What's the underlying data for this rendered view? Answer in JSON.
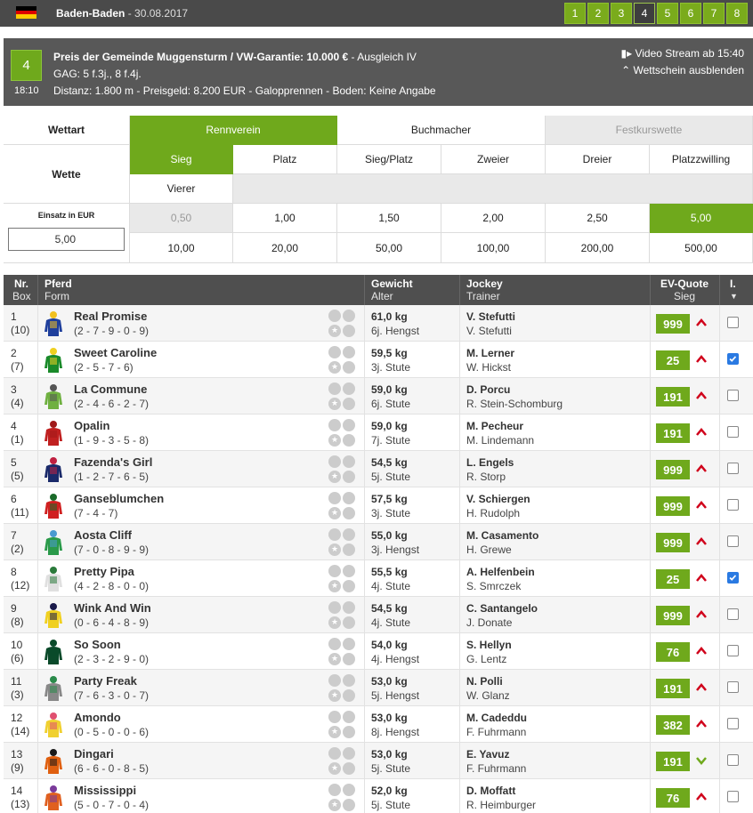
{
  "header": {
    "flag_colors": [
      "#000000",
      "#dd0000",
      "#ffcc00"
    ],
    "meeting": "Baden-Baden",
    "date": "30.08.2017",
    "race_numbers": [
      "1",
      "2",
      "3",
      "4",
      "5",
      "6",
      "7",
      "8"
    ],
    "active_race": "4"
  },
  "race": {
    "number": "4",
    "time": "18:10",
    "title": "Preis der Gemeinde Muggensturm / VW-Garantie: 10.000 €",
    "class": " - Ausgleich IV",
    "gag": "GAG: 5 f.3j., 8 f.4j.",
    "details": "Distanz: 1.800 m - Preisgeld: 8.200 EUR - Galopprennen - Boden: Keine Angabe",
    "video_stream": "Video Stream ab 15:40",
    "hide_ticket": "Wettschein ausblenden"
  },
  "bet": {
    "wettart_label": "Wettart",
    "providers": [
      "Rennverein",
      "Buchmacher",
      "Festkurswette"
    ],
    "wette_label": "Wette",
    "bet_types": [
      "Sieg",
      "Platz",
      "Sieg/Platz",
      "Zweier",
      "Dreier",
      "Platzzwilling"
    ],
    "bet_types_row2": [
      "Vierer"
    ],
    "einsatz_label": "Einsatz in EUR",
    "einsatz_value": "5,00",
    "stakes_row1": [
      "0,50",
      "1,00",
      "1,50",
      "2,00",
      "2,50",
      "5,00"
    ],
    "stakes_row2": [
      "10,00",
      "20,00",
      "50,00",
      "100,00",
      "200,00",
      "500,00"
    ]
  },
  "table": {
    "headers": {
      "nr": "Nr.",
      "box": "Box",
      "pferd": "Pferd",
      "form": "Form",
      "gewicht": "Gewicht",
      "alter": "Alter",
      "jockey": "Jockey",
      "trainer": "Trainer",
      "quote": "EV-Quote",
      "sieg": "Sieg",
      "i": "I."
    },
    "rows": [
      {
        "nr": "1",
        "box": "(10)",
        "name": "Real Promise",
        "form": "(2 - 7 - 9 - 0 - 9)",
        "weight": "61,0 kg",
        "age": "6j. Hengst",
        "jockey": "V. Stefutti",
        "trainer": "V. Stefutti",
        "odds": "999",
        "trend": "up",
        "checked": false,
        "silk": [
          "#f0c020",
          "#1f3f9c"
        ]
      },
      {
        "nr": "2",
        "box": "(7)",
        "name": "Sweet Caroline",
        "form": "(2 - 5 - 7 - 6)",
        "weight": "59,5 kg",
        "age": "3j. Stute",
        "jockey": "M. Lerner",
        "trainer": "W. Hickst",
        "odds": "25",
        "trend": "up",
        "checked": true,
        "silk": [
          "#f0d020",
          "#1a8a2a"
        ]
      },
      {
        "nr": "3",
        "box": "(4)",
        "name": "La Commune",
        "form": "(2 - 4 - 6 - 2 - 7)",
        "weight": "59,0 kg",
        "age": "6j. Stute",
        "jockey": "D. Porcu",
        "trainer": "R. Stein-Schomburg",
        "odds": "191",
        "trend": "up",
        "checked": false,
        "silk": [
          "#555555",
          "#6fb040"
        ]
      },
      {
        "nr": "4",
        "box": "(1)",
        "name": "Opalin",
        "form": "(1 - 9 - 3 - 5 - 8)",
        "weight": "59,0 kg",
        "age": "7j. Stute",
        "jockey": "M. Pecheur",
        "trainer": "M. Lindemann",
        "odds": "191",
        "trend": "up",
        "checked": false,
        "silk": [
          "#a01a1a",
          "#c02020"
        ]
      },
      {
        "nr": "5",
        "box": "(5)",
        "name": "Fazenda's Girl",
        "form": "(1 - 2 - 7 - 6 - 5)",
        "weight": "54,5 kg",
        "age": "5j. Stute",
        "jockey": "L. Engels",
        "trainer": "R. Storp",
        "odds": "999",
        "trend": "up",
        "checked": false,
        "silk": [
          "#c02040",
          "#1a2a6a"
        ]
      },
      {
        "nr": "6",
        "box": "(11)",
        "name": "Ganseblumchen",
        "form": "(7 - 4 - 7)",
        "weight": "57,5 kg",
        "age": "3j. Stute",
        "jockey": "V. Schiergen",
        "trainer": "H. Rudolph",
        "odds": "999",
        "trend": "up",
        "checked": false,
        "silk": [
          "#1a6a2a",
          "#d02020"
        ]
      },
      {
        "nr": "7",
        "box": "(2)",
        "name": "Aosta Cliff",
        "form": "(7 - 0 - 8 - 9 - 9)",
        "weight": "55,0 kg",
        "age": "3j. Hengst",
        "jockey": "M. Casamento",
        "trainer": "H. Grewe",
        "odds": "999",
        "trend": "up",
        "checked": false,
        "silk": [
          "#4a9ad0",
          "#2a9a4a"
        ]
      },
      {
        "nr": "8",
        "box": "(12)",
        "name": "Pretty Pipa",
        "form": "(4 - 2 - 8 - 0 - 0)",
        "weight": "55,5 kg",
        "age": "4j. Stute",
        "jockey": "A. Helfenbein",
        "trainer": "S. Smrczek",
        "odds": "25",
        "trend": "up",
        "checked": true,
        "silk": [
          "#2a7a3a",
          "#e0e0e0"
        ]
      },
      {
        "nr": "9",
        "box": "(8)",
        "name": "Wink And Win",
        "form": "(0 - 6 - 4 - 8 - 9)",
        "weight": "54,5 kg",
        "age": "4j. Stute",
        "jockey": "C. Santangelo",
        "trainer": "J. Donate",
        "odds": "999",
        "trend": "up",
        "checked": false,
        "silk": [
          "#1a1a4a",
          "#f0d020"
        ]
      },
      {
        "nr": "10",
        "box": "(6)",
        "name": "So Soon",
        "form": "(2 - 3 - 2 - 9 - 0)",
        "weight": "54,0 kg",
        "age": "4j. Hengst",
        "jockey": "S. Hellyn",
        "trainer": "G. Lentz",
        "odds": "76",
        "trend": "up",
        "checked": false,
        "silk": [
          "#0a4a2a",
          "#0a4a2a"
        ]
      },
      {
        "nr": "11",
        "box": "(3)",
        "name": "Party Freak",
        "form": "(7 - 6 - 3 - 0 - 7)",
        "weight": "53,0 kg",
        "age": "5j. Hengst",
        "jockey": "N. Polli",
        "trainer": "W. Glanz",
        "odds": "191",
        "trend": "up",
        "checked": false,
        "silk": [
          "#2a8a4a",
          "#888888"
        ]
      },
      {
        "nr": "12",
        "box": "(14)",
        "name": "Amondo",
        "form": "(0 - 5 - 0 - 0 - 6)",
        "weight": "53,0 kg",
        "age": "8j. Hengst",
        "jockey": "M. Cadeddu",
        "trainer": "F. Fuhrmann",
        "odds": "382",
        "trend": "up",
        "checked": false,
        "silk": [
          "#e05070",
          "#f0d030"
        ]
      },
      {
        "nr": "13",
        "box": "(9)",
        "name": "Dingari",
        "form": "(6 - 6 - 0 - 8 - 5)",
        "weight": "53,0 kg",
        "age": "5j. Stute",
        "jockey": "E. Yavuz",
        "trainer": "F. Fuhrmann",
        "odds": "191",
        "trend": "down",
        "checked": false,
        "silk": [
          "#1a1a1a",
          "#e06010"
        ]
      },
      {
        "nr": "14",
        "box": "(13)",
        "name": "Mississippi",
        "form": "(5 - 0 - 7 - 0 - 4)",
        "weight": "52,0 kg",
        "age": "5j. Stute",
        "jockey": "D. Moffatt",
        "trainer": "R. Heimburger",
        "odds": "76",
        "trend": "up",
        "checked": false,
        "silk": [
          "#7a3a9a",
          "#e06020"
        ]
      }
    ]
  },
  "colors": {
    "accent_green": "#6fa91c",
    "dark_bar": "#4a4a4a",
    "trend_up": "#d0021b",
    "trend_down": "#6fa91c",
    "checkbox_checked": "#2a7ae2"
  }
}
